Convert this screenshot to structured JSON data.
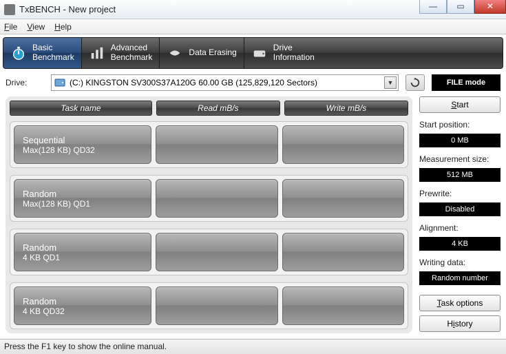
{
  "window": {
    "title": "TxBENCH - New project"
  },
  "menu": {
    "file": "File",
    "view": "View",
    "help": "Help"
  },
  "tabs": {
    "basic": {
      "l1": "Basic",
      "l2": "Benchmark"
    },
    "advanced": {
      "l1": "Advanced",
      "l2": "Benchmark"
    },
    "erase": {
      "l1": "Data Erasing",
      "l2": ""
    },
    "info": {
      "l1": "Drive",
      "l2": "Information"
    }
  },
  "drive": {
    "label": "Drive:",
    "selected": "(C:) KINGSTON SV300S37A120G  60.00 GB (125,829,120 Sectors)",
    "filemode": "FILE mode"
  },
  "headers": {
    "task": "Task name",
    "read": "Read mB/s",
    "write": "Write mB/s"
  },
  "tasks": [
    {
      "name_l1": "Sequential",
      "name_l2": "Max(128 KB) QD32",
      "read": "",
      "write": ""
    },
    {
      "name_l1": "Random",
      "name_l2": "Max(128 KB) QD1",
      "read": "",
      "write": ""
    },
    {
      "name_l1": "Random",
      "name_l2": "4 KB QD1",
      "read": "",
      "write": ""
    },
    {
      "name_l1": "Random",
      "name_l2": "4 KB QD32",
      "read": "",
      "write": ""
    }
  ],
  "side": {
    "start": "Start",
    "startpos_lbl": "Start position:",
    "startpos_val": "0 MB",
    "msize_lbl": "Measurement size:",
    "msize_val": "512 MB",
    "prewrite_lbl": "Prewrite:",
    "prewrite_val": "Disabled",
    "align_lbl": "Alignment:",
    "align_val": "4 KB",
    "wdata_lbl": "Writing data:",
    "wdata_val": "Random number",
    "taskopt": "Task options",
    "history": "History"
  },
  "status": "Press the F1 key to show the online manual."
}
